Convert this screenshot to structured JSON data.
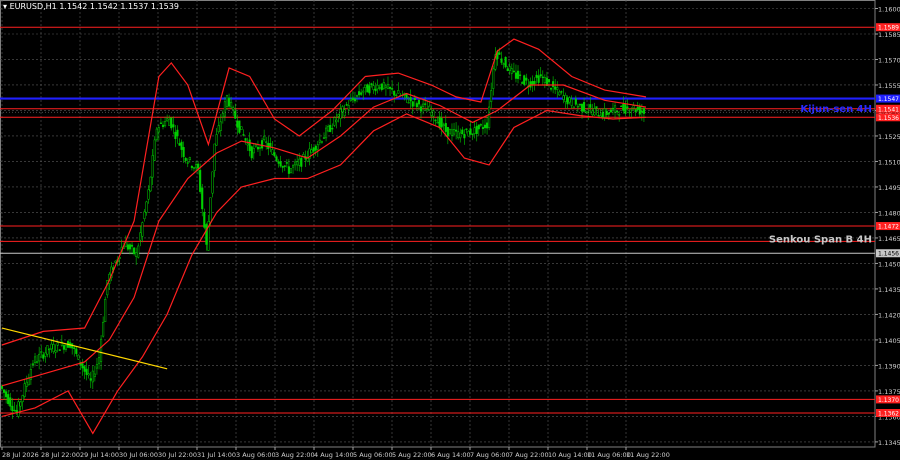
{
  "header": {
    "symbol_timeframe": "EURUSD,H1",
    "ohlc": "1.1542 1.1542 1.1537 1.1539"
  },
  "chart_data": {
    "type": "candlestick",
    "symbol": "EURUSD",
    "timeframe": "H1",
    "ylim": [
      1.1342,
      1.1605
    ],
    "grid": true,
    "price_ticks": [
      "1.1600",
      "1.1585",
      "1.1570",
      "1.1555",
      "1.1540",
      "1.1525",
      "1.1510",
      "1.1495",
      "1.1480",
      "1.1465",
      "1.1450",
      "1.1435",
      "1.1420",
      "1.1405",
      "1.1390",
      "1.1375",
      "1.1360",
      "1.1345"
    ],
    "time_labels": [
      "28 Jul 2026",
      "28 Jul 22:00",
      "29 Jul 14:00",
      "30 Jul 06:00",
      "30 Jul 22:00",
      "31 Jul 14:00",
      "3 Aug 06:00",
      "3 Aug 22:00",
      "4 Aug 14:00",
      "5 Aug 06:00",
      "5 Aug 22:00",
      "6 Aug 14:00",
      "7 Aug 06:00",
      "7 Aug 22:00",
      "10 Aug 14:00",
      "11 Aug 06:00",
      "11 Aug 22:00"
    ],
    "horizontal_levels": [
      {
        "price": 1.1589,
        "label": "1.1589",
        "color": "#ff2020"
      },
      {
        "price": 1.1547,
        "label": "1.1547",
        "color": "#2020ff"
      },
      {
        "price": 1.1541,
        "label": "1.1541",
        "color": "#ff2020"
      },
      {
        "price": 1.1536,
        "label": "1.1536",
        "color": "#ff2020"
      },
      {
        "price": 1.1472,
        "label": "1.1472",
        "color": "#ff2020"
      },
      {
        "price": 1.1463,
        "label": "",
        "color": "#ff2020"
      },
      {
        "price": 1.1456,
        "label": "1.1456",
        "color": "#c8c8c8"
      },
      {
        "price": 1.137,
        "label": "1.1370",
        "color": "#ff2020"
      },
      {
        "price": 1.1362,
        "label": "1.1362",
        "color": "#ff2020"
      }
    ],
    "line_annotations": [
      {
        "text": "Kijun-sen 4H",
        "price": 1.1541,
        "color": "#2a2aff"
      },
      {
        "text": "Senkou Span B 4H",
        "price": 1.1464,
        "color": "#c8c8c8"
      }
    ],
    "trendline": {
      "color": "#ffd700",
      "start": {
        "bar": 0,
        "price": 1.1412
      },
      "end": {
        "bar": 40,
        "price": 1.1388
      }
    },
    "price_path": [
      [
        0,
        1.1378
      ],
      [
        4,
        1.1362
      ],
      [
        8,
        1.1392
      ],
      [
        12,
        1.14
      ],
      [
        17,
        1.1403
      ],
      [
        22,
        1.138
      ],
      [
        24,
        1.1395
      ],
      [
        26,
        1.144
      ],
      [
        30,
        1.1462
      ],
      [
        33,
        1.1455
      ],
      [
        36,
        1.1492
      ],
      [
        38,
        1.153
      ],
      [
        41,
        1.1535
      ],
      [
        45,
        1.1512
      ],
      [
        48,
        1.1505
      ],
      [
        50,
        1.146
      ],
      [
        52,
        1.152
      ],
      [
        55,
        1.1548
      ],
      [
        58,
        1.153
      ],
      [
        61,
        1.1515
      ],
      [
        64,
        1.1522
      ],
      [
        67,
        1.1512
      ],
      [
        70,
        1.1505
      ],
      [
        73,
        1.151
      ],
      [
        76,
        1.1518
      ],
      [
        80,
        1.153
      ],
      [
        84,
        1.1543
      ],
      [
        88,
        1.1552
      ],
      [
        92,
        1.1555
      ],
      [
        96,
        1.155
      ],
      [
        100,
        1.1545
      ],
      [
        104,
        1.154
      ],
      [
        108,
        1.1528
      ],
      [
        111,
        1.1526
      ],
      [
        115,
        1.1528
      ],
      [
        118,
        1.1532
      ],
      [
        120,
        1.1575
      ],
      [
        124,
        1.1562
      ],
      [
        128,
        1.1556
      ],
      [
        131,
        1.156
      ],
      [
        134,
        1.1553
      ],
      [
        138,
        1.1545
      ],
      [
        142,
        1.1541
      ],
      [
        146,
        1.1538
      ],
      [
        149,
        1.154
      ],
      [
        153,
        1.1542
      ],
      [
        156,
        1.1539
      ]
    ],
    "bollinger": {
      "color": "#ff2020",
      "upper": [
        [
          0,
          1.1402
        ],
        [
          10,
          1.141
        ],
        [
          20,
          1.1412
        ],
        [
          26,
          1.144
        ],
        [
          32,
          1.1475
        ],
        [
          38,
          1.156
        ],
        [
          41,
          1.1568
        ],
        [
          45,
          1.1555
        ],
        [
          50,
          1.152
        ],
        [
          55,
          1.1565
        ],
        [
          60,
          1.156
        ],
        [
          66,
          1.1535
        ],
        [
          72,
          1.1525
        ],
        [
          80,
          1.154
        ],
        [
          88,
          1.156
        ],
        [
          96,
          1.1562
        ],
        [
          104,
          1.1555
        ],
        [
          110,
          1.1548
        ],
        [
          116,
          1.1545
        ],
        [
          120,
          1.1575
        ],
        [
          124,
          1.1582
        ],
        [
          130,
          1.1576
        ],
        [
          138,
          1.156
        ],
        [
          146,
          1.1552
        ],
        [
          156,
          1.1548
        ]
      ],
      "middle": [
        [
          0,
          1.1378
        ],
        [
          10,
          1.1385
        ],
        [
          20,
          1.1392
        ],
        [
          26,
          1.1405
        ],
        [
          32,
          1.143
        ],
        [
          38,
          1.1475
        ],
        [
          45,
          1.15
        ],
        [
          52,
          1.1515
        ],
        [
          58,
          1.1522
        ],
        [
          66,
          1.1518
        ],
        [
          74,
          1.1512
        ],
        [
          82,
          1.1525
        ],
        [
          90,
          1.1542
        ],
        [
          98,
          1.155
        ],
        [
          106,
          1.1543
        ],
        [
          114,
          1.1533
        ],
        [
          120,
          1.154
        ],
        [
          128,
          1.1555
        ],
        [
          136,
          1.1555
        ],
        [
          146,
          1.1546
        ],
        [
          156,
          1.1542
        ]
      ],
      "lower": [
        [
          0,
          1.136
        ],
        [
          8,
          1.1365
        ],
        [
          16,
          1.1375
        ],
        [
          22,
          1.135
        ],
        [
          28,
          1.1375
        ],
        [
          34,
          1.1395
        ],
        [
          40,
          1.142
        ],
        [
          46,
          1.1455
        ],
        [
          52,
          1.148
        ],
        [
          58,
          1.1495
        ],
        [
          66,
          1.15
        ],
        [
          74,
          1.15
        ],
        [
          82,
          1.1508
        ],
        [
          90,
          1.1528
        ],
        [
          98,
          1.1538
        ],
        [
          106,
          1.153
        ],
        [
          112,
          1.1512
        ],
        [
          118,
          1.1508
        ],
        [
          124,
          1.153
        ],
        [
          132,
          1.154
        ],
        [
          140,
          1.1537
        ],
        [
          148,
          1.1535
        ],
        [
          156,
          1.1536
        ]
      ]
    }
  }
}
